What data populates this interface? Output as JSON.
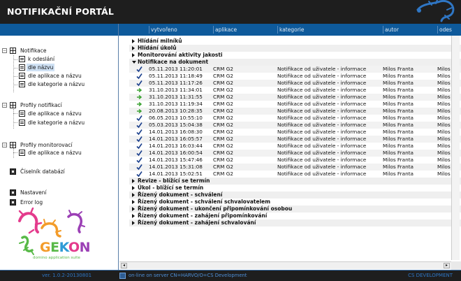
{
  "app": {
    "title": "NOTIFIKAČNÍ PORTÁL"
  },
  "columns": [
    "vytvořeno",
    "aplikace",
    "kategorie",
    "autor",
    "odes"
  ],
  "tree": [
    {
      "label": "Notifikace",
      "icon": "grid-icon"
    },
    {
      "label": "k odeslání",
      "icon": "list-icon"
    },
    {
      "label": "dle názvu",
      "icon": "list-icon"
    },
    {
      "label": "dle aplikace a názvu",
      "icon": "list-icon"
    },
    {
      "label": "dle kategorie a názvu",
      "icon": "list-icon"
    },
    {
      "label": "Profily notifikací",
      "icon": "grid-icon"
    },
    {
      "label": "dle aplikace a názvu",
      "icon": "list-icon"
    },
    {
      "label": "dle kategorie a názvu",
      "icon": "list-icon"
    },
    {
      "label": "Profily monitorovací",
      "icon": "grid-icon"
    },
    {
      "label": "dle aplikace a názvu",
      "icon": "list-icon"
    },
    {
      "label": "Číselník databází",
      "icon": "database-icon"
    },
    {
      "label": "Nastavení",
      "icon": "settings-icon"
    },
    {
      "label": "Error log",
      "icon": "log-icon"
    }
  ],
  "selected_tree_index": 2,
  "groups_top": [
    "Hlídání milníků",
    "Hlídání úkolů",
    "Monitorování aktivity jakosti",
    "Notifikace na dokument"
  ],
  "rows": [
    {
      "date": "05.11.2013 11:20:01",
      "app": "CRM G2",
      "cat": "Notifikace od uživatele - informace",
      "author": "Milos Franta",
      "sender": "Milos",
      "status": "check"
    },
    {
      "date": "05.11.2013 11:18:49",
      "app": "CRM G2",
      "cat": "Notifikace od uživatele - informace",
      "author": "Milos Franta",
      "sender": "Milos",
      "status": "check"
    },
    {
      "date": "05.11.2013 11:17:26",
      "app": "CRM G2",
      "cat": "Notifikace od uživatele - informace",
      "author": "Milos Franta",
      "sender": "Milos",
      "status": "check"
    },
    {
      "date": "31.10.2013 11:34:01",
      "app": "CRM G2",
      "cat": "Notifikace od uživatele - informace",
      "author": "Milos Franta",
      "sender": "Milos",
      "status": "arrow"
    },
    {
      "date": "31.10.2013 11:31:55",
      "app": "CRM G2",
      "cat": "Notifikace od uživatele - informace",
      "author": "Milos Franta",
      "sender": "Milos",
      "status": "arrow"
    },
    {
      "date": "31.10.2013 11:19:34",
      "app": "CRM G2",
      "cat": "Notifikace od uživatele - informace",
      "author": "Milos Franta",
      "sender": "Milos",
      "status": "arrow"
    },
    {
      "date": "20.08.2013 10:28:35",
      "app": "CRM G2",
      "cat": "Notifikace od uživatele - informace",
      "author": "Milos Franta",
      "sender": "Milos",
      "status": "arrow"
    },
    {
      "date": "06.05.2013 10:55:10",
      "app": "CRM G2",
      "cat": "Notifikace od uživatele - informace",
      "author": "Milos Franta",
      "sender": "Milos",
      "status": "check"
    },
    {
      "date": "05.03.2013 15:04:38",
      "app": "CRM G2",
      "cat": "Notifikace od uživatele - informace",
      "author": "Milos Franta",
      "sender": "Milos",
      "status": "check"
    },
    {
      "date": "14.01.2013 16:08:30",
      "app": "CRM G2",
      "cat": "Notifikace od uživatele - informace",
      "author": "Milos Franta",
      "sender": "Milos",
      "status": "check"
    },
    {
      "date": "14.01.2013 16:05:57",
      "app": "CRM G2",
      "cat": "Notifikace od uživatele - informace",
      "author": "Milos Franta",
      "sender": "Milos",
      "status": "check"
    },
    {
      "date": "14.01.2013 16:03:44",
      "app": "CRM G2",
      "cat": "Notifikace od uživatele - informace",
      "author": "Milos Franta",
      "sender": "Milos",
      "status": "check"
    },
    {
      "date": "14.01.2013 16:00:54",
      "app": "CRM G2",
      "cat": "Notifikace od uživatele - informace",
      "author": "Milos Franta",
      "sender": "Milos",
      "status": "check"
    },
    {
      "date": "14.01.2013 15:47:46",
      "app": "CRM G2",
      "cat": "Notifikace od uživatele - informace",
      "author": "Milos Franta",
      "sender": "Milos",
      "status": "check"
    },
    {
      "date": "14.01.2013 15:31:08",
      "app": "CRM G2",
      "cat": "Notifikace od uživatele - informace",
      "author": "Milos Franta",
      "sender": "Milos",
      "status": "check"
    },
    {
      "date": "14.01.2013 15:02:51",
      "app": "CRM G2",
      "cat": "Notifikace od uživatele - informace",
      "author": "Milos Franta",
      "sender": "Milos",
      "status": "check"
    }
  ],
  "groups_bottom": [
    "Revize - blížící se termín",
    "Úkol - blížící se termín",
    "Řízený dokument - schválení",
    "Řízený dokument - schválení schvalovatelem",
    "Řízený dokument - ukončení připomínkování osobou",
    "Řízený dokument - zahájení připomínkování",
    "Řízený dokument - zahájení schvalování"
  ],
  "logo": {
    "name": "GEKON",
    "tagline": "domino application suite"
  },
  "footer": {
    "version": "ver. 1.0.2-20130801",
    "status": "on-line on server CN=HARVO/O=CS Development",
    "brand": "CS DEVELOPMENT"
  },
  "colors": {
    "header_blue": "#0e5a9b",
    "check": "#1a3f8c",
    "arrow": "#3da335",
    "logo_orange": "#f39c2a",
    "logo_pink": "#e43b8c"
  }
}
